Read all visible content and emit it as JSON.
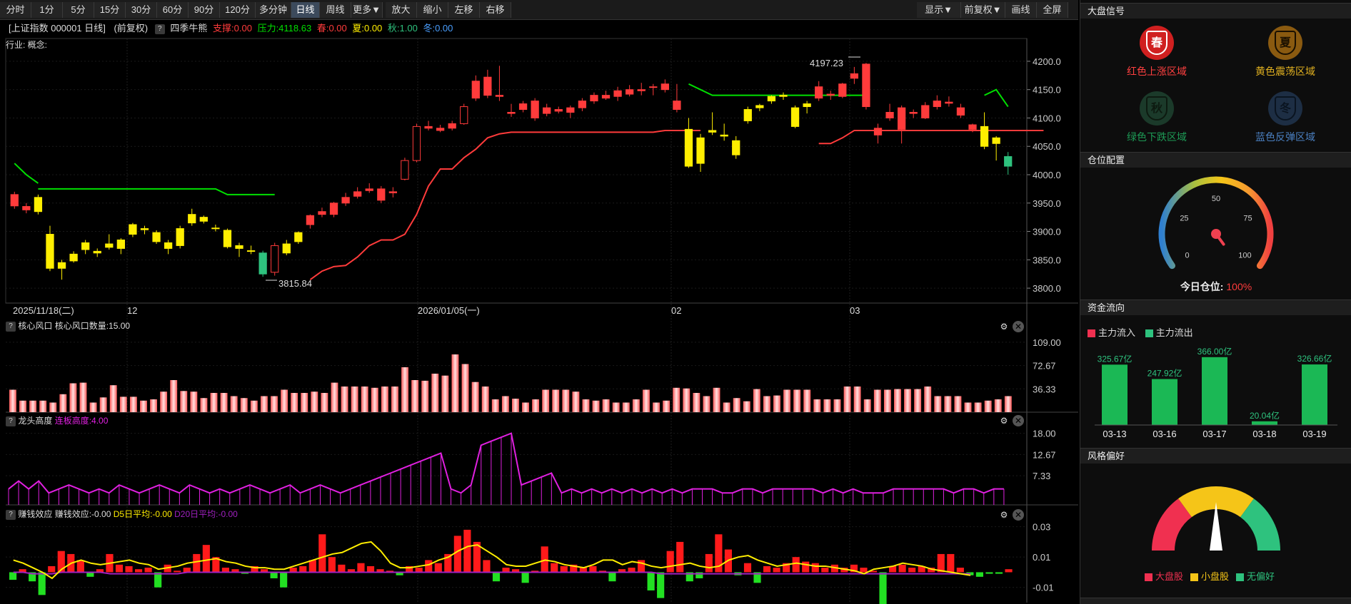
{
  "toolbar": {
    "periods": [
      "分时",
      "1分",
      "5分",
      "15分",
      "30分",
      "60分",
      "90分",
      "120分",
      "多分钟",
      "日线",
      "周线",
      "更多▼",
      "放大",
      "缩小",
      "左移",
      "右移"
    ],
    "active": "日线",
    "right": [
      "显示▼",
      "前复权▼",
      "画线",
      "全屏"
    ]
  },
  "info": {
    "name": "[上证指数 000001 日线]",
    "adj": "(前复权)",
    "ind": "四季牛熊",
    "support": "支撑:0.00",
    "pressure": "压力:4118.63",
    "spring": "春:0.00",
    "summer": "夏:0.00",
    "autumn": "秋:1.00",
    "winter": "冬:0.00",
    "industry": "行业: 概念:"
  },
  "colors": {
    "up": "#ff3b3b",
    "down": "#2ec27e",
    "yellow": "#ffee00",
    "green": "#00e000",
    "magenta": "#e020e0",
    "panelBg": "#000000"
  },
  "main_chart": {
    "y_ticks": [
      "4200.0",
      "4150.0",
      "4100.0",
      "4050.0",
      "4000.0",
      "3950.0",
      "3900.0",
      "3850.0",
      "3800.0"
    ],
    "ymin": 3780,
    "ymax": 4220,
    "x_labels": [
      "2025/11/18(二)",
      "12",
      "2026/01/05(一)",
      "02",
      "03"
    ],
    "annotations": {
      "high": "4197.23",
      "low": "3815.84"
    },
    "candles": [
      [
        3965,
        3945,
        3970,
        3940,
        "r"
      ],
      [
        3944,
        3938,
        3950,
        3932,
        "r"
      ],
      [
        3935,
        3960,
        3965,
        3930,
        "y"
      ],
      [
        3895,
        3835,
        3910,
        3830,
        "y"
      ],
      [
        3845,
        3835,
        3850,
        3815,
        "y"
      ],
      [
        3848,
        3860,
        3865,
        3845,
        "y"
      ],
      [
        3868,
        3880,
        3885,
        3860,
        "y"
      ],
      [
        3862,
        3865,
        3870,
        3855,
        "y"
      ],
      [
        3872,
        3878,
        3895,
        3868,
        "y"
      ],
      [
        3870,
        3885,
        3888,
        3860,
        "y"
      ],
      [
        3912,
        3895,
        3915,
        3890,
        "y"
      ],
      [
        3905,
        3903,
        3910,
        3895,
        "y"
      ],
      [
        3898,
        3882,
        3902,
        3878,
        "y"
      ],
      [
        3880,
        3870,
        3885,
        3860,
        "y"
      ],
      [
        3875,
        3905,
        3910,
        3870,
        "y"
      ],
      [
        3915,
        3930,
        3940,
        3910,
        "y"
      ],
      [
        3925,
        3918,
        3928,
        3914,
        "y"
      ],
      [
        3905,
        3906,
        3912,
        3900,
        "y"
      ],
      [
        3902,
        3873,
        3905,
        3870,
        "y"
      ],
      [
        3875,
        3870,
        3880,
        3855,
        "y"
      ],
      [
        3865,
        3866,
        3875,
        3860,
        "y"
      ],
      [
        3862,
        3825,
        3866,
        3820,
        "g"
      ],
      [
        3828,
        3875,
        3880,
        3822,
        "o"
      ],
      [
        3862,
        3878,
        3885,
        3858,
        "y"
      ],
      [
        3882,
        3898,
        3900,
        3878,
        "y"
      ],
      [
        3912,
        3928,
        3930,
        3905,
        "r"
      ],
      [
        3930,
        3935,
        3942,
        3925,
        "r"
      ],
      [
        3930,
        3950,
        3952,
        3925,
        "r"
      ],
      [
        3950,
        3960,
        3968,
        3945,
        "r"
      ],
      [
        3962,
        3970,
        3978,
        3958,
        "r"
      ],
      [
        3972,
        3975,
        3985,
        3968,
        "r"
      ],
      [
        3975,
        3955,
        3980,
        3950,
        "r"
      ],
      [
        3968,
        3970,
        3978,
        3960,
        "r"
      ],
      [
        3992,
        4025,
        4030,
        3990,
        "o"
      ],
      [
        4025,
        4085,
        4090,
        4022,
        "o"
      ],
      [
        4082,
        4085,
        4095,
        4078,
        "r"
      ],
      [
        4078,
        4082,
        4088,
        4075,
        "r"
      ],
      [
        4082,
        4090,
        4095,
        4078,
        "r"
      ],
      [
        4090,
        4120,
        4125,
        4088,
        "o"
      ],
      [
        4135,
        4165,
        4175,
        4130,
        "r"
      ],
      [
        4172,
        4140,
        4185,
        4135,
        "r"
      ],
      [
        4140,
        4138,
        4192,
        4130,
        "r"
      ],
      [
        4110,
        4108,
        4125,
        4102,
        "r"
      ],
      [
        4115,
        4125,
        4130,
        4110,
        "r"
      ],
      [
        4130,
        4100,
        4135,
        4095,
        "r"
      ],
      [
        4108,
        4118,
        4125,
        4103,
        "r"
      ],
      [
        4115,
        4112,
        4120,
        4108,
        "r"
      ],
      [
        4110,
        4118,
        4122,
        4100,
        "r"
      ],
      [
        4118,
        4130,
        4135,
        4112,
        "r"
      ],
      [
        4130,
        4140,
        4145,
        4125,
        "r"
      ],
      [
        4140,
        4135,
        4148,
        4132,
        "r"
      ],
      [
        4148,
        4138,
        4155,
        4130,
        "r"
      ],
      [
        4142,
        4150,
        4158,
        4138,
        "r"
      ],
      [
        4148,
        4150,
        4162,
        4140,
        "r"
      ],
      [
        4155,
        4155,
        4160,
        4140,
        "r"
      ],
      [
        4160,
        4150,
        4168,
        4145,
        "r"
      ],
      [
        4130,
        4115,
        4160,
        4110,
        "r"
      ],
      [
        4080,
        4015,
        4100,
        4012,
        "y"
      ],
      [
        4020,
        4065,
        4072,
        4005,
        "y"
      ],
      [
        4075,
        4078,
        4110,
        4070,
        "y"
      ],
      [
        4068,
        4070,
        4090,
        4060,
        "y"
      ],
      [
        4035,
        4060,
        4068,
        4028,
        "y"
      ],
      [
        4095,
        4115,
        4120,
        4090,
        "y"
      ],
      [
        4118,
        4122,
        4125,
        4112,
        "y"
      ],
      [
        4130,
        4138,
        4140,
        4125,
        "y"
      ],
      [
        4138,
        4140,
        4145,
        4132,
        "y"
      ],
      [
        4118,
        4085,
        4122,
        4082,
        "y"
      ],
      [
        4120,
        4125,
        4130,
        4108,
        "y"
      ],
      [
        4135,
        4155,
        4165,
        4130,
        "r"
      ],
      [
        4140,
        4142,
        4148,
        4132,
        "r"
      ],
      [
        4138,
        4160,
        4162,
        4135,
        "r"
      ],
      [
        4170,
        4178,
        4190,
        4160,
        "r"
      ],
      [
        4195,
        4120,
        4197,
        4115,
        "r"
      ],
      [
        4070,
        4082,
        4090,
        4055,
        "r"
      ],
      [
        4100,
        4110,
        4125,
        4095,
        "r"
      ],
      [
        4080,
        4118,
        4122,
        4055,
        "r"
      ],
      [
        4110,
        4108,
        4115,
        4100,
        "r"
      ],
      [
        4100,
        4122,
        4128,
        4098,
        "r"
      ],
      [
        4120,
        4130,
        4140,
        4115,
        "r"
      ],
      [
        4128,
        4126,
        4138,
        4120,
        "r"
      ],
      [
        4105,
        4118,
        4125,
        4100,
        "r"
      ],
      [
        4080,
        4088,
        4090,
        4075,
        "r"
      ],
      [
        4085,
        4050,
        4110,
        4045,
        "y"
      ],
      [
        4055,
        4065,
        4068,
        4025,
        "y"
      ],
      [
        4032,
        4015,
        4040,
        4000,
        "g"
      ]
    ],
    "support_seg1": [
      4020,
      4000,
      3985,
      3975,
      3975,
      3975,
      3975,
      3975,
      3975,
      3975,
      3975,
      3975,
      3975,
      3975,
      3975,
      3975,
      3975,
      3975,
      3975,
      3965,
      3965,
      3965,
      3965,
      3965
    ],
    "support_seg2": [
      4160,
      4150,
      4140,
      4140,
      4140,
      4140,
      4140,
      4140,
      4140,
      4140,
      4140,
      4140,
      4140,
      4140,
      4140,
      4140
    ],
    "support_seg3": [
      4140,
      4150,
      4120
    ],
    "red_seg1": [
      3815,
      3830,
      3838,
      3840,
      3855,
      3875,
      3885,
      3885,
      3895,
      3930,
      3980,
      4010,
      4010,
      4030,
      4045,
      4065,
      4072,
      4075,
      4075,
      4075,
      4075,
      4075,
      4075,
      4075,
      4075,
      4075,
      4075,
      4075,
      4075,
      4075,
      4078,
      4078,
      4078,
      4078
    ],
    "red_seg2": [
      4055,
      4055,
      4065,
      4078,
      4078,
      4078,
      4078,
      4078,
      4078,
      4078,
      4078,
      4078,
      4078,
      4078,
      4078,
      4078,
      4078,
      4078,
      4078,
      4078
    ]
  },
  "panel1": {
    "label": "核心风口",
    "sub": "核心风口数量:15.00",
    "y_ticks": [
      "109.00",
      "72.67",
      "36.33"
    ],
    "ymax": 120,
    "values": [
      35,
      18,
      18,
      18,
      15,
      28,
      45,
      46,
      15,
      23,
      42,
      24,
      24,
      18,
      20,
      32,
      50,
      33,
      32,
      22,
      30,
      30,
      25,
      22,
      18,
      25,
      25,
      35,
      30,
      30,
      32,
      30,
      46,
      40,
      40,
      40,
      38,
      40,
      40,
      70,
      50,
      49,
      60,
      57,
      90,
      75,
      47,
      40,
      20,
      25,
      21,
      15,
      20,
      35,
      35,
      35,
      32,
      20,
      18,
      20,
      15,
      15,
      20,
      35,
      15,
      18,
      38,
      37,
      30,
      25,
      38,
      15,
      22,
      17,
      36,
      25,
      26,
      35,
      35,
      35,
      20,
      20,
      20,
      40,
      40,
      20,
      35,
      35,
      36,
      36,
      36,
      40,
      25,
      25,
      25,
      15,
      15,
      18,
      20,
      25
    ]
  },
  "panel2": {
    "label": "龙头高度",
    "sub": "连板高度:4.00",
    "y_ticks": [
      "18.00",
      "12.67",
      "7.33"
    ],
    "ymax": 19,
    "values": [
      4,
      6,
      4,
      6,
      3,
      4,
      5,
      4,
      3,
      4,
      3,
      5,
      4,
      3,
      4,
      5,
      4,
      3,
      5,
      4,
      3,
      4,
      3,
      4,
      5,
      4,
      3,
      4,
      5,
      3,
      4,
      5,
      4,
      3,
      4,
      5,
      6,
      7,
      8,
      9,
      10,
      11,
      12,
      13,
      4,
      3,
      5,
      15,
      16,
      17,
      18,
      5,
      6,
      7,
      8,
      3,
      4,
      3,
      4,
      3,
      4,
      3,
      4,
      3,
      4,
      3,
      4,
      3,
      4,
      4,
      4,
      3,
      3,
      4,
      4,
      3,
      4,
      4,
      4,
      4,
      4,
      3,
      4,
      3,
      4,
      3,
      3,
      3,
      4,
      4,
      4,
      4,
      4,
      4,
      3,
      4,
      4,
      3,
      4,
      4
    ]
  },
  "panel3": {
    "label": "赚钱效应",
    "sub": "赚钱效应:-0.00",
    "d5": "D5日平均:-0.00",
    "d20": "D20日平均:-0.00",
    "y_ticks": [
      "0.03",
      "0.01",
      "-0.01"
    ],
    "ymin": -0.02,
    "ymax": 0.035,
    "values": [
      -0.005,
      0.002,
      -0.006,
      -0.015,
      0.004,
      0.014,
      0.012,
      0.008,
      -0.003,
      0.002,
      0.012,
      0.005,
      0.004,
      0.002,
      0.003,
      -0.01,
      0.005,
      0.001,
      0.003,
      0.012,
      0.018,
      0.01,
      0.003,
      0.002,
      -0.001,
      0.004,
      0.002,
      -0.004,
      -0.01,
      0.003,
      0.004,
      0.008,
      0.025,
      0.01,
      0.005,
      0.002,
      0.006,
      0.004,
      0.002,
      0.001,
      -0.002,
      0.004,
      0.003,
      0.008,
      0.006,
      0.012,
      0.024,
      0.028,
      0.02,
      0.008,
      -0.006,
      0.003,
      0.002,
      -0.007,
      0.001,
      0.017,
      0.006,
      0.004,
      0.005,
      0.003,
      0.004,
      0.001,
      -0.006,
      0.002,
      0.003,
      0.008,
      -0.012,
      -0.017,
      0.014,
      0.02,
      -0.006,
      -0.004,
      0.012,
      0.025,
      0.015,
      -0.002,
      0.006,
      -0.007,
      0.004,
      0.003,
      0.006,
      0.01,
      0.007,
      0.006,
      0.003,
      0.005,
      0.003,
      0.005,
      0.003,
      0.001,
      -0.022,
      0.004,
      0.005,
      0.003,
      0.004,
      0.003,
      0.012,
      0.012,
      0.003,
      -0.002,
      -0.003,
      -0.001,
      -0.001,
      0.002
    ],
    "ma5": [
      0.008,
      0.006,
      0.003,
      0.0,
      -0.004,
      0.002,
      0.006,
      0.008,
      0.006,
      0.005,
      0.006,
      0.007,
      0.008,
      0.006,
      0.005,
      0.002,
      0.003,
      0.004,
      0.006,
      0.007,
      0.008,
      0.009,
      0.007,
      0.006,
      0.004,
      0.003,
      0.003,
      0.002,
      0.002,
      0.004,
      0.006,
      0.008,
      0.01,
      0.012,
      0.013,
      0.016,
      0.019,
      0.02,
      0.014,
      0.006,
      0.003,
      0.003,
      0.004,
      0.005,
      0.008,
      0.01,
      0.014,
      0.017,
      0.018,
      0.014,
      0.01,
      0.005,
      0.004,
      0.004,
      0.006,
      0.008,
      0.007,
      0.005,
      0.004,
      0.003,
      0.005,
      0.008,
      0.008,
      0.005,
      0.007,
      0.006,
      0.004,
      0.003,
      0.004,
      0.005,
      0.006,
      0.004,
      0.003,
      0.004,
      0.008,
      0.01,
      0.011,
      0.008,
      0.006,
      0.004,
      0.005,
      0.006,
      0.005,
      0.004,
      0.004,
      0.003,
      0.002,
      0.001,
      -0.001,
      0.002,
      0.003,
      0.004,
      0.006,
      0.005,
      0.004,
      0.002,
      0.001,
      0.0,
      -0.001,
      -0.002
    ],
    "ma20": [
      0.0,
      0.0,
      -0.001,
      -0.001,
      -0.001,
      0.0,
      0.0,
      0.0,
      0.0,
      0.0,
      -0.001,
      -0.001,
      -0.001,
      -0.001,
      -0.001,
      -0.001,
      -0.001,
      -0.001,
      0.0,
      0.0,
      0.0,
      0.0,
      0.0,
      0.0,
      0.0,
      0.0,
      0.0,
      0.0,
      0.0,
      0.0,
      0.0,
      0.0,
      0.0,
      0.0,
      0.0,
      0.0,
      0.0,
      0.0,
      0.0,
      0.0,
      0.0,
      0.0,
      0.0,
      0.0,
      0.0,
      0.0,
      0.0,
      0.0,
      0.0,
      0.0,
      0.0,
      0.0,
      0.0,
      0.0,
      0.0,
      0.0,
      0.0,
      0.0,
      0.0,
      0.0,
      0.0,
      0.0,
      0.0,
      0.0,
      0.0,
      0.0,
      0.0,
      -0.001,
      -0.001,
      -0.001,
      -0.001,
      -0.001,
      -0.001,
      -0.001,
      -0.001,
      -0.001,
      -0.001,
      -0.001,
      -0.001,
      -0.001,
      -0.001,
      -0.001,
      -0.001,
      -0.001,
      -0.001,
      -0.001,
      -0.001,
      -0.001,
      -0.001,
      -0.001,
      -0.001,
      -0.001,
      -0.001,
      -0.001,
      -0.001,
      -0.001,
      -0.001,
      -0.001,
      -0.001,
      -0.001
    ]
  },
  "sidebar": {
    "market_title": "大盘信号",
    "signals": [
      {
        "glyph": "春",
        "label": "红色上涨区域",
        "color": "#ff4040",
        "bg": "#d02020",
        "fg": "#ffffff"
      },
      {
        "glyph": "夏",
        "label": "黄色震荡区域",
        "color": "#e0b020",
        "bg": "#8a5a10",
        "fg": "#1a1000"
      },
      {
        "glyph": "秋",
        "label": "绿色下跌区域",
        "color": "#1d9a55",
        "bg": "#1b3a2a",
        "fg": "#0d1a10"
      },
      {
        "glyph": "冬",
        "label": "蓝色反弹区域",
        "color": "#4a7fc0",
        "bg": "#1d2e44",
        "fg": "#0a1420"
      }
    ],
    "position_title": "仓位配置",
    "gauge_ticks": [
      "0",
      "25",
      "50",
      "75",
      "100"
    ],
    "gauge_value": 0.06,
    "position_label": "今日仓位:",
    "position_value": "100%",
    "flow_title": "资金流向",
    "flow_legend_in": "主力流入",
    "flow_legend_out": "主力流出",
    "flow": [
      {
        "date": "03-13",
        "value": 325.67,
        "label": "325.67亿"
      },
      {
        "date": "03-16",
        "value": 247.92,
        "label": "247.92亿"
      },
      {
        "date": "03-17",
        "value": 366.0,
        "label": "366.00亿"
      },
      {
        "date": "03-18",
        "value": 20.04,
        "label": "20.04亿"
      },
      {
        "date": "03-19",
        "value": 326.66,
        "label": "326.66亿"
      }
    ],
    "style_title": "风格偏好",
    "style_legend": [
      {
        "label": "大盘股",
        "color": "#f03050"
      },
      {
        "label": "小盘股",
        "color": "#f5c518"
      },
      {
        "label": "无偏好",
        "color": "#2ec27e"
      }
    ]
  }
}
